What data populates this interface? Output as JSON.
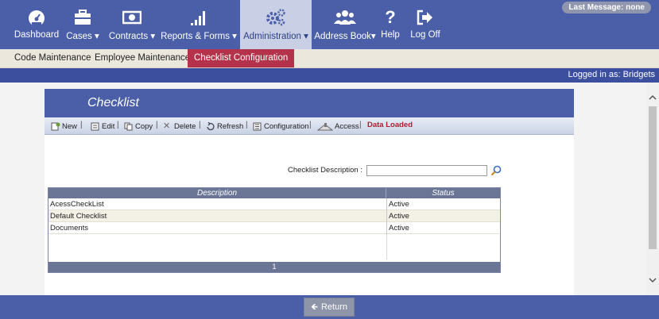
{
  "nav": {
    "items": [
      {
        "label": "Dashboard",
        "icon": "dashboard-gauge-icon"
      },
      {
        "label": "Cases ▾",
        "icon": "briefcase-icon"
      },
      {
        "label": "Contracts ▾",
        "icon": "money-icon"
      },
      {
        "label": "Reports & Forms ▾",
        "icon": "bar-chart-icon"
      },
      {
        "label": "Administration ▾",
        "icon": "gears-icon",
        "active": true
      },
      {
        "label": "Address Book▾",
        "icon": "users-icon"
      },
      {
        "label": "Help",
        "icon": "question-icon"
      },
      {
        "label": "Log Off",
        "icon": "logout-icon"
      }
    ],
    "last_message": "Last Message: none"
  },
  "subnav": {
    "items": [
      {
        "label": "Code Maintenance"
      },
      {
        "label": "Employee Maintenance"
      },
      {
        "label": "Checklist Configuration",
        "active": true
      }
    ]
  },
  "logged_in": "Logged in as: Bridgets",
  "panel": {
    "title": "Checklist",
    "toolbar": {
      "new": "New",
      "edit": "Edit",
      "copy": "Copy",
      "delete": "Delete",
      "refresh": "Refresh",
      "configuration": "Configuration",
      "access": "Access",
      "status": "Data Loaded",
      "separator": "|"
    },
    "search": {
      "label": "Checklist Description :",
      "value": ""
    },
    "grid": {
      "columns": [
        "Description",
        "Status"
      ],
      "rows": [
        {
          "description": "AcessCheckList",
          "status": "Active"
        },
        {
          "description": "Default Checklist",
          "status": "Active"
        },
        {
          "description": "Documents",
          "status": "Active"
        }
      ],
      "page": "1"
    }
  },
  "footer": {
    "return_label": "Return",
    "return_arrow": "🡸"
  },
  "colors": {
    "nav_bg": "#4a5fa8",
    "accent_red": "#b5334a",
    "status_red": "#b01c2e"
  }
}
